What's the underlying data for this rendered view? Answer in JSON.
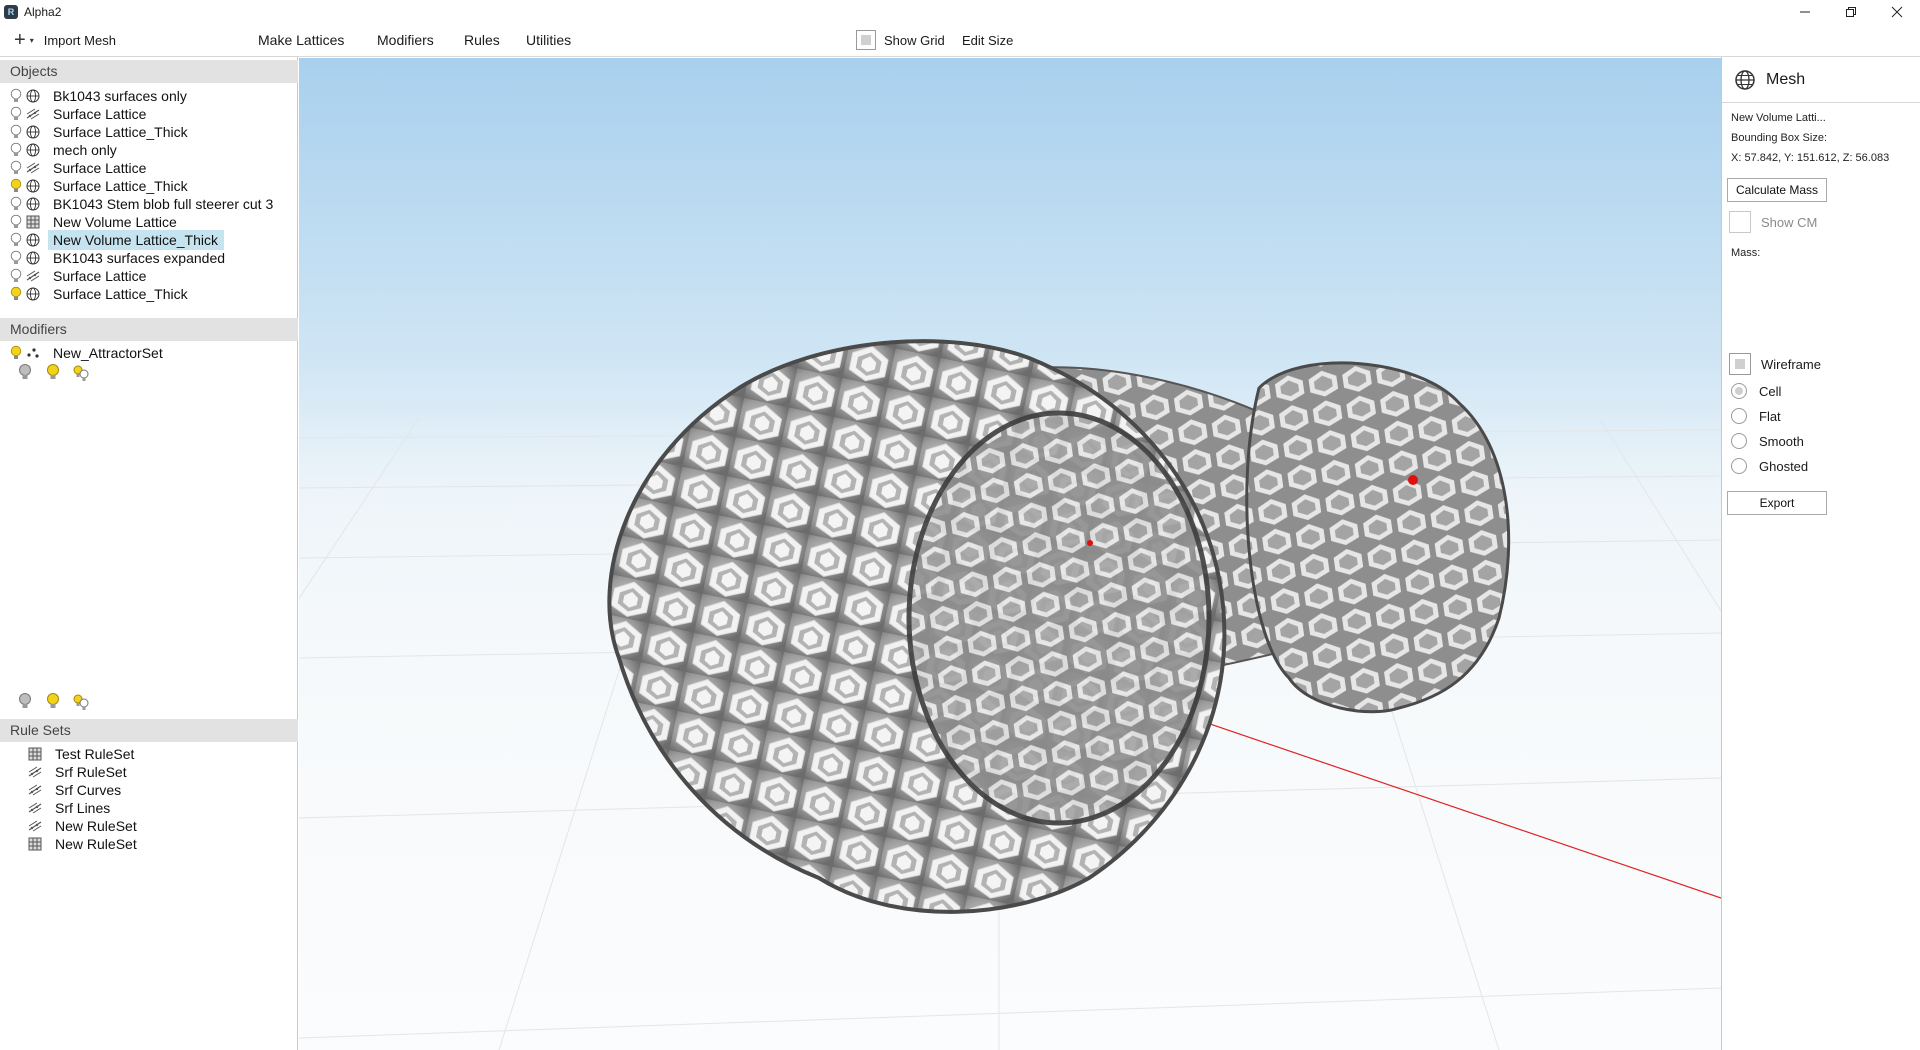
{
  "window": {
    "title": "Alpha2",
    "app_icon_glyph": "R"
  },
  "toolbar": {
    "import_label": "Import Mesh",
    "menus": [
      "Make Lattices",
      "Modifiers",
      "Rules",
      "Utilities"
    ],
    "show_grid_label": "Show Grid",
    "show_grid_checked": false,
    "edit_size_label": "Edit Size"
  },
  "objects": {
    "header": "Objects",
    "items": [
      {
        "label": "Bk1043 surfaces only",
        "visible": false,
        "icon": "globe-icon"
      },
      {
        "label": "Surface Lattice",
        "visible": false,
        "icon": "lattice-icon"
      },
      {
        "label": "Surface Lattice_Thick",
        "visible": false,
        "icon": "globe-icon"
      },
      {
        "label": "mech only",
        "visible": false,
        "icon": "globe-icon"
      },
      {
        "label": "Surface Lattice",
        "visible": false,
        "icon": "lattice-icon"
      },
      {
        "label": "Surface Lattice_Thick",
        "visible": true,
        "icon": "globe-icon"
      },
      {
        "label": "BK1043 Stem blob full steerer cut 3",
        "visible": false,
        "icon": "globe-icon"
      },
      {
        "label": "New Volume Lattice",
        "visible": false,
        "icon": "grid-icon"
      },
      {
        "label": "New Volume Lattice_Thick",
        "visible": false,
        "icon": "globe-icon",
        "selected": true
      },
      {
        "label": "BK1043 surfaces expanded",
        "visible": false,
        "icon": "globe-icon"
      },
      {
        "label": "Surface Lattice",
        "visible": false,
        "icon": "lattice-icon"
      },
      {
        "label": "Surface Lattice_Thick",
        "visible": true,
        "icon": "globe-icon"
      }
    ]
  },
  "modifiers": {
    "header": "Modifiers",
    "items": [
      {
        "label": "New_AttractorSet",
        "visible": true,
        "icon": "attractor-icon"
      }
    ]
  },
  "rulesets": {
    "header": "Rule Sets",
    "items": [
      {
        "label": "Test RuleSet",
        "icon": "grid-icon"
      },
      {
        "label": "Srf RuleSet",
        "icon": "lattice-icon"
      },
      {
        "label": "Srf Curves",
        "icon": "lattice-icon"
      },
      {
        "label": "Srf Lines",
        "icon": "lattice-icon"
      },
      {
        "label": "New RuleSet",
        "icon": "lattice-icon"
      },
      {
        "label": "New RuleSet",
        "icon": "grid-icon"
      }
    ]
  },
  "properties": {
    "header": "Mesh",
    "name": "New Volume Latti...",
    "bbox_label": "Bounding Box Size:",
    "bbox_value": "X: 57.842, Y: 151.612, Z: 56.083",
    "calc_mass_label": "Calculate Mass",
    "show_cm_label": "Show CM",
    "mass_label": "Mass:",
    "wireframe_label": "Wireframe",
    "render_modes": [
      "Cell",
      "Flat",
      "Smooth",
      "Ghosted"
    ],
    "render_mode_selected": "Cell",
    "export_label": "Export"
  },
  "colors": {
    "selection": "#c6e4f0",
    "section_header": "#e2e2e2",
    "sky_top": "#a8d0ee",
    "x_axis": "#e02020",
    "y_axis": "#20c020",
    "bulb_on": "#f3d21a"
  }
}
